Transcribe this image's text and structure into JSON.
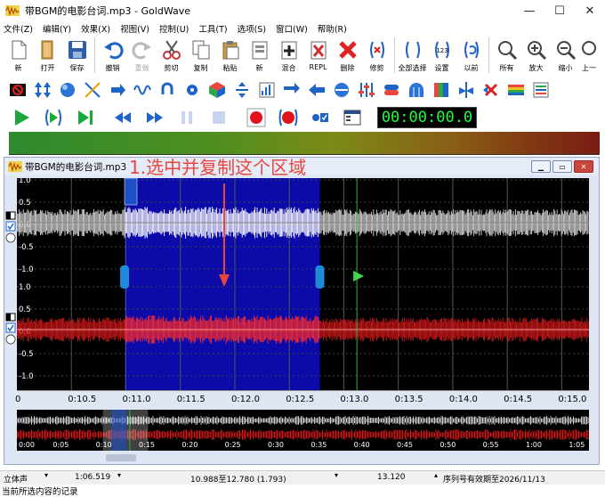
{
  "window": {
    "title": "带BGM的电影台词.mp3 - GoldWave",
    "minimize": "—",
    "maximize": "☐",
    "close": "✕"
  },
  "menu": [
    "文件(Z)",
    "编辑(Y)",
    "效果(X)",
    "视图(V)",
    "控制(U)",
    "工具(T)",
    "选项(S)",
    "窗口(W)",
    "帮助(R)"
  ],
  "toolbar_main": [
    {
      "icon": "new-file-icon",
      "label": "新"
    },
    {
      "icon": "open-folder-icon",
      "label": "打开"
    },
    {
      "icon": "save-icon",
      "label": "保存"
    },
    {
      "icon": "undo-icon",
      "label": "撤销"
    },
    {
      "icon": "redo-icon",
      "label": "重做",
      "disabled": true
    },
    {
      "icon": "cut-icon",
      "label": "剪切"
    },
    {
      "icon": "copy-icon",
      "label": "复制"
    },
    {
      "icon": "paste-icon",
      "label": "粘贴"
    },
    {
      "icon": "paste-new-icon",
      "label": "新"
    },
    {
      "icon": "mix-icon",
      "label": "混合"
    },
    {
      "icon": "replace-icon",
      "label": "REPL"
    },
    {
      "icon": "delete-icon",
      "label": "删除"
    },
    {
      "icon": "trim-icon",
      "label": "修剪"
    },
    {
      "icon": "select-all-icon",
      "label": "全部选择"
    },
    {
      "icon": "set-marker-icon",
      "label": "设置"
    },
    {
      "icon": "previous-icon",
      "label": "以前"
    },
    {
      "icon": "zoom-all-icon",
      "label": "所有"
    },
    {
      "icon": "zoom-in-icon",
      "label": "放大"
    },
    {
      "icon": "zoom-out-icon",
      "label": "缩小"
    },
    {
      "icon": "zoom-previous-icon",
      "label": "上一"
    }
  ],
  "transport": {
    "time": "00:00:00.0"
  },
  "document": {
    "title": "带BGM的电影台词.mp3",
    "annotation": "1.选中并复制这个区域",
    "channel_ticks": [
      "1.0",
      "0.5",
      "0.0",
      "-0.5",
      "-1.0"
    ],
    "timeline_ticks": [
      "0",
      "0:10.5",
      "0:11.0",
      "0:11.5",
      "0:12.0",
      "0:12.5",
      "0:13.0",
      "0:13.5",
      "0:14.0",
      "0:14.5",
      "0:15.0"
    ],
    "overview_ticks": [
      "0:00",
      "0:05",
      "0:10",
      "0:15",
      "0:20",
      "0:25",
      "0:30",
      "0:35",
      "0:40",
      "0:45",
      "0:50",
      "0:55",
      "1:00",
      "1:05"
    ],
    "selection": {
      "start": 10.988,
      "end": 12.78,
      "view_start": 10.0,
      "view_end": 15.25
    },
    "cursor": 13.12
  },
  "status": {
    "mode": "立体声",
    "duration": "1:06.519",
    "selection": "10.988至12.780 (1.793)",
    "cursor": "13.120",
    "license": "序列号有效期至2026/11/13",
    "message": "当前所选内容的记录"
  }
}
